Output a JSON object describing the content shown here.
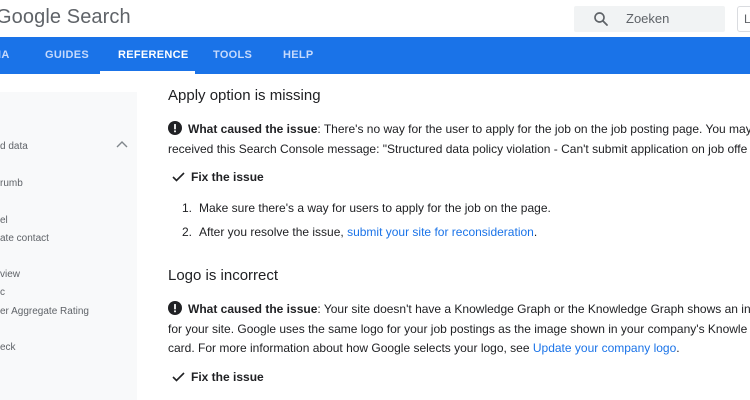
{
  "header": {
    "brand": "Google Search",
    "search_placeholder": "Zoeken",
    "lang_label": "L"
  },
  "nav": {
    "tabs": [
      {
        "label": "IA",
        "active": false
      },
      {
        "label": "GUIDES",
        "active": false
      },
      {
        "label": "REFERENCE",
        "active": true
      },
      {
        "label": "TOOLS",
        "active": false
      },
      {
        "label": "HELP",
        "active": false
      }
    ]
  },
  "sidebar": {
    "items": [
      {
        "label": "d data"
      },
      {
        "label": "rumb"
      },
      {
        "label": "el"
      },
      {
        "label": "ate contact"
      },
      {
        "label": "view"
      },
      {
        "label": "c"
      },
      {
        "label": "er Aggregate Rating"
      },
      {
        "label": "eck"
      }
    ]
  },
  "content": {
    "section1": {
      "title": "Apply option is missing",
      "cause_label": "What caused the issue",
      "cause_line1_rest": ": There's no way for the user to apply for the job on the job posting page. You may",
      "cause_line2": "received this Search Console message: \"Structured data policy violation - Can't submit application on job offe",
      "fix_label": "Fix the issue",
      "steps": [
        {
          "num": "1.",
          "text": "Make sure there's a way for users to apply for the job on the page.",
          "link": ""
        },
        {
          "num": "2.",
          "text": "After you resolve the issue, ",
          "link": "submit your site for reconsideration",
          "after": "."
        }
      ]
    },
    "section2": {
      "title": "Logo is incorrect",
      "cause_label": "What caused the issue",
      "cause_line1_rest": ": Your site doesn't have a Knowledge Graph or the Knowledge Graph shows an inc",
      "cause_line2": "for your site. Google uses the same logo for your job postings as the image shown in your company's Knowle",
      "cause_line3": "card. For more information about how Google selects your logo, see ",
      "cause_link": "Update your company logo",
      "cause_line3_after": ".",
      "fix_label": "Fix the issue"
    }
  },
  "colors": {
    "brand_blue": "#1a73e8",
    "nav_inactive": "#c6dafc",
    "sidebar_bg": "#f8f9fa",
    "link": "#1a73e8"
  }
}
